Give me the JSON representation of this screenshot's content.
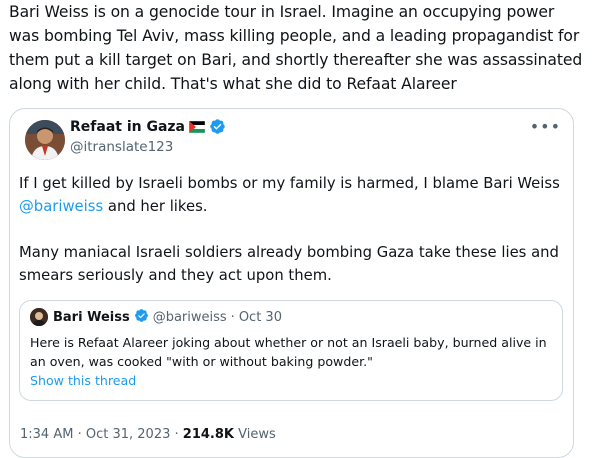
{
  "tweet": {
    "text": "Bari Weiss is on a genocide tour in Israel. Imagine an occupying power was bombing Tel Aviv, mass killing people, and a leading propagandist for them put a kill target on Bari, and shortly thereafter she was assassinated along with her child. That's what she did to Refaat Alareer"
  },
  "quoted": {
    "author_name": "Refaat in Gaza",
    "author_handle": "@itranslate123",
    "more_icon": "more-horizontal-icon",
    "para1_before": "If I get killed by Israeli bombs or my family is harmed, I blame Bari Weiss ",
    "mention": "@bariweiss",
    "para1_after": " and her likes.",
    "para2": "Many maniacal Israeli soldiers already bombing Gaza take these lies and smears seriously and they act upon them.",
    "inner": {
      "author_name": "Bari Weiss",
      "author_handle": "@bariweiss",
      "separator": "·",
      "date": "Oct 30",
      "text": "Here is Refaat Alareer joking about whether or not an Israeli baby, burned alive in an oven, was cooked \"with or without baking powder.\"",
      "show_thread": "Show this thread"
    },
    "time": "1:34 AM",
    "date": "Oct 31, 2023",
    "separator": "·",
    "views_count": "214.8K",
    "views_label": "Views"
  },
  "colors": {
    "link": "#1d9bf0",
    "text": "#0f1419",
    "muted": "#536471",
    "border": "#cfd9de"
  }
}
